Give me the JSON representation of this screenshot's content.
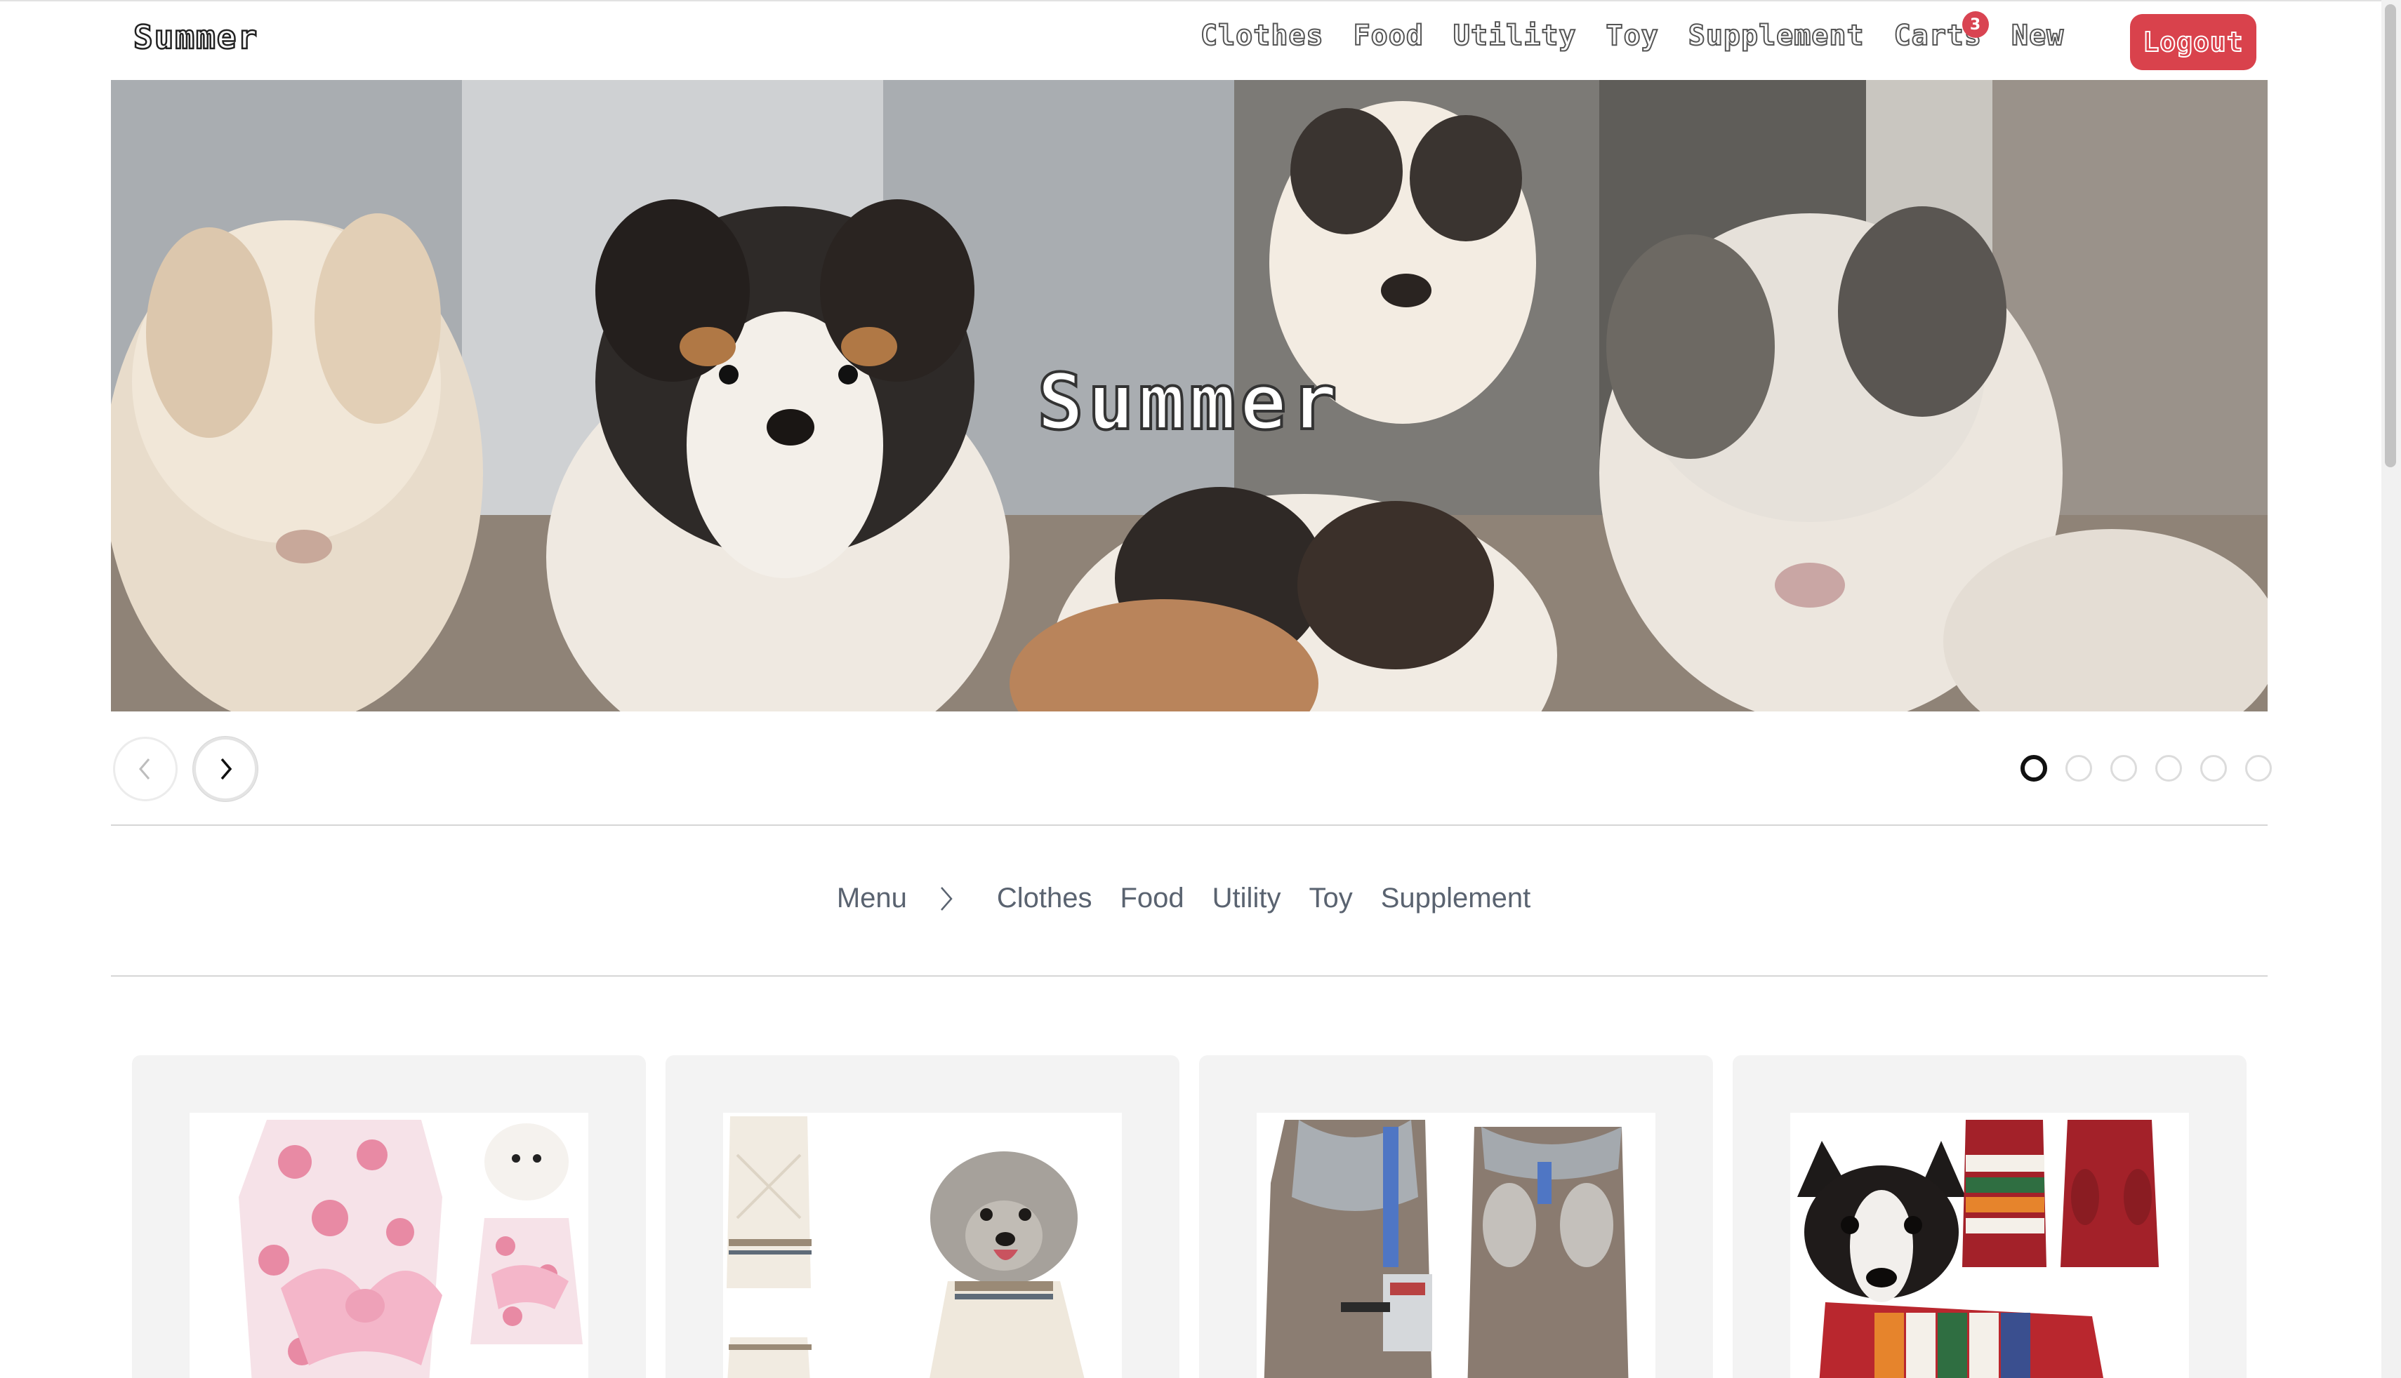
{
  "brand": "Summer",
  "nav": {
    "links": [
      "Clothes",
      "Food",
      "Utility",
      "Toy",
      "Supplement",
      "Carts",
      "New"
    ],
    "cart_count": "3",
    "logout_label": "Logout"
  },
  "hero": {
    "title": "Summer",
    "slide_count": 6,
    "active_slide": 1
  },
  "category_menu": {
    "label": "Menu",
    "items": [
      "Clothes",
      "Food",
      "Utility",
      "Toy",
      "Supplement"
    ]
  },
  "products": [
    {
      "icon": "floral-dog-dress-image"
    },
    {
      "icon": "cream-knit-sweater-image"
    },
    {
      "icon": "fleece-sports-vest-image"
    },
    {
      "icon": "striped-knit-sweater-image"
    }
  ],
  "colors": {
    "accent": "#d9424c",
    "badge": "#d94452",
    "menu_text": "#5a6370",
    "card_bg": "#f3f3f3"
  }
}
